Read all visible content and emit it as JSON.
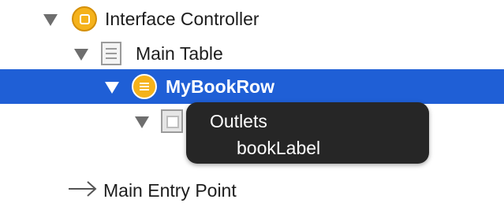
{
  "tree": {
    "interface_controller": {
      "label": "Interface Controller"
    },
    "main_table": {
      "label": "Main Table"
    },
    "my_book_row": {
      "label": "MyBookRow"
    },
    "main_entry_point": {
      "label": "Main Entry Point"
    }
  },
  "popup": {
    "title": "Outlets",
    "items": [
      "bookLabel"
    ]
  },
  "colors": {
    "selection": "#1f5fd6",
    "controller_icon": "#f5b21b",
    "popup_background": "#262626"
  },
  "icons": [
    "disclosure-triangle-icon",
    "interface-controller-icon",
    "table-icon",
    "table-row-controller-icon",
    "group-icon",
    "arrow-right-icon"
  ]
}
